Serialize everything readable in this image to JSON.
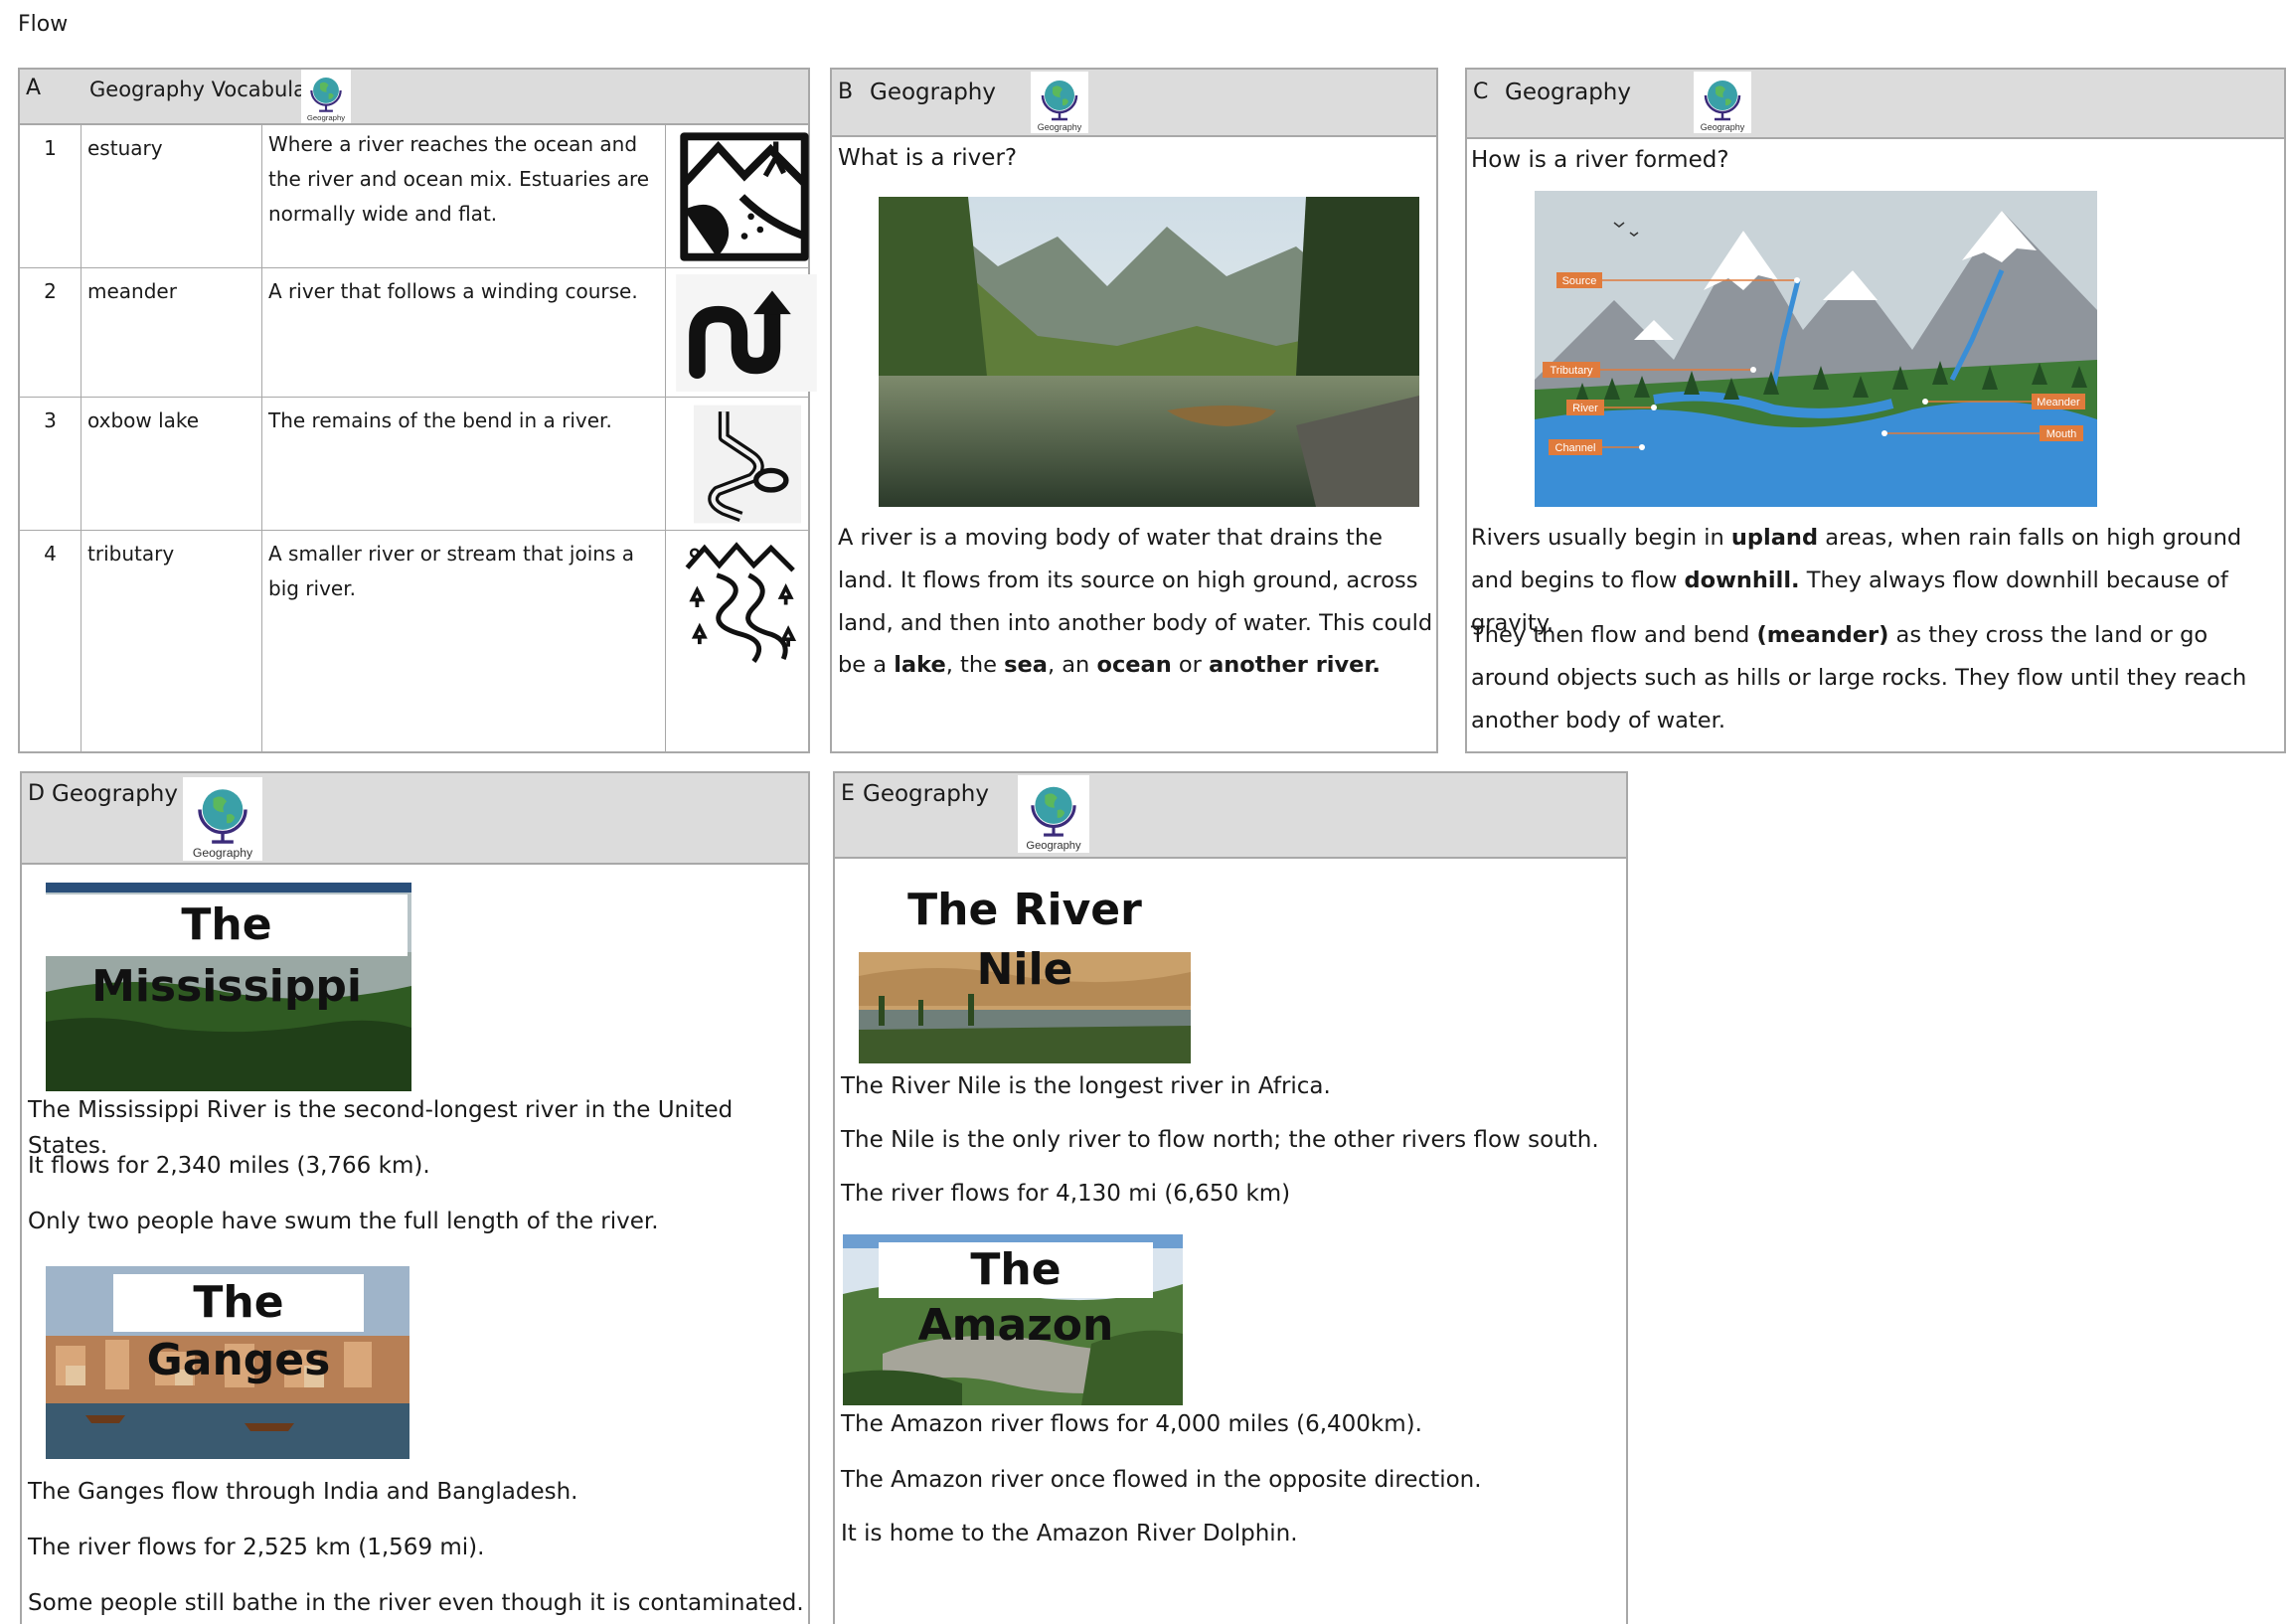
{
  "page_title": "Flow",
  "panel_a": {
    "letter": "A",
    "title": "Geography Vocabulary",
    "logo_label": "Geography",
    "rows": [
      {
        "num": "1",
        "term": "estuary",
        "definition": "Where a river reaches the ocean and the river and ocean mix. Estuaries are normally wide and flat.",
        "icon": "estuary-icon"
      },
      {
        "num": "2",
        "term": "meander",
        "definition": "A river that follows a winding course.",
        "icon": "meander-icon"
      },
      {
        "num": "3",
        "term": "oxbow lake",
        "definition": "The remains of the bend in a river.",
        "icon": "oxbow-lake-icon"
      },
      {
        "num": "4",
        "term": "tributary",
        "definition": "A smaller river or stream that joins a big river.",
        "icon": "tributary-icon"
      }
    ]
  },
  "panel_b": {
    "letter": "B",
    "title": "Geography",
    "logo_label": "Geography",
    "question": "What is a river?",
    "text_parts": [
      "A river is a moving body of water that drains the land. It flows from its source on high ground, across land, and then into another body of water. This could be a ",
      "lake",
      ", the ",
      "sea",
      ", an ",
      "ocean",
      " or ",
      "another river."
    ]
  },
  "panel_c": {
    "letter": "C",
    "title": "Geography",
    "logo_label": "Geography",
    "question": "How is a river formed?",
    "diagram_labels": {
      "source": "Source",
      "tributary": "Tributary",
      "river": "River",
      "channel": "Channel",
      "meander": "Meander",
      "mouth": "Mouth"
    },
    "p1_parts": [
      "Rivers usually begin in ",
      "upland",
      " areas, when rain falls on high ground and begins to flow ",
      "downhill.",
      " They always flow downhill because of gravity."
    ],
    "p2_parts": [
      "They then flow and bend ",
      "(meander)",
      " as they cross the land or go around objects such as hills or large rocks. They flow until they reach another body of water."
    ]
  },
  "panel_d": {
    "letter": "D",
    "title": "Geography",
    "logo_label": "Geography",
    "mississippi_caption": "The Mississippi",
    "mississippi_facts": [
      "The Mississippi River is the second-longest river in the United States.",
      "It flows for 2,340 miles (3,766 km).",
      "Only two people have swum the full length of the river."
    ],
    "ganges_caption": "The Ganges",
    "ganges_facts": [
      "The Ganges flow through India and Bangladesh.",
      "The river flows for 2,525 km (1,569 mi).",
      "Some people still bathe in the river even though it is contaminated."
    ]
  },
  "panel_e": {
    "letter": "E",
    "title": "Geography",
    "logo_label": "Geography",
    "nile_caption": "The River Nile",
    "nile_facts": [
      "The River Nile  is the longest river in Africa.",
      "The Nile is the only river to flow north; the other rivers flow south.",
      "The river flows for 4,130 mi (6,650 km)"
    ],
    "amazon_caption": "The Amazon",
    "amazon_facts": [
      "The Amazon river flows for 4,000 miles (6,400km).",
      "The Amazon river once flowed in the opposite direction.",
      "It is home to the Amazon River Dolphin."
    ]
  },
  "colors": {
    "header_bg": "#dcdcdc",
    "border": "#a8a8a8",
    "label_orange": "#e07b3c"
  }
}
